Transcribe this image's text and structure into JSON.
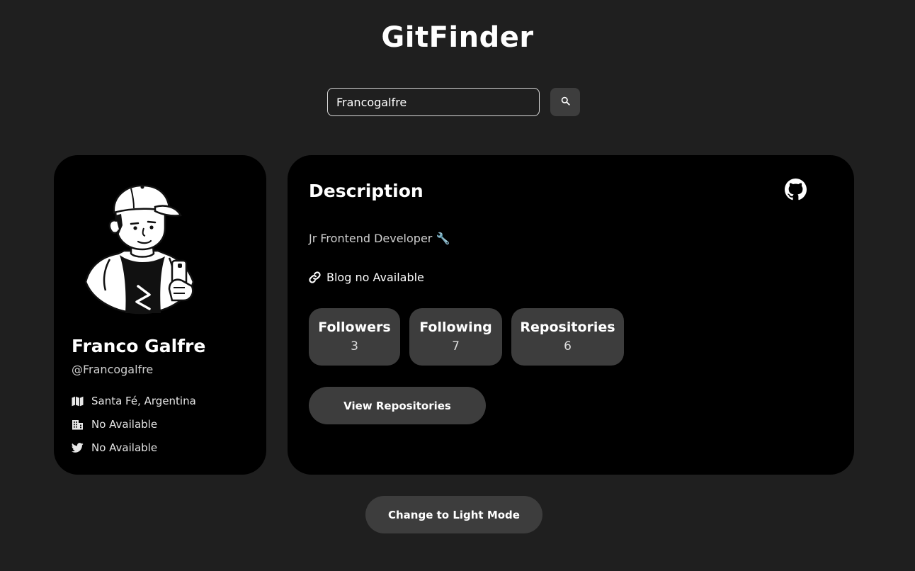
{
  "app": {
    "title": "GitFinder"
  },
  "search": {
    "value": "Francogalfre",
    "placeholder": "",
    "button_icon": "search-icon"
  },
  "profile": {
    "name": "Franco Galfre",
    "handle": "@Francogalfre",
    "location": "Santa Fé, Argentina",
    "company": "No Available",
    "twitter": "No Available",
    "icons": {
      "location": "map-icon",
      "company": "building-icon",
      "twitter": "twitter-icon"
    }
  },
  "details": {
    "title": "Description",
    "bio": "Jr Frontend Developer 🔧",
    "blog": "Blog no Available",
    "stats": [
      {
        "label": "Followers",
        "value": "3"
      },
      {
        "label": "Following",
        "value": "7"
      },
      {
        "label": "Repositories",
        "value": "6"
      }
    ],
    "view_repos_label": "View Repositories",
    "github_icon": "github-icon"
  },
  "theme_toggle": {
    "label": "Change to Light Mode"
  },
  "colors": {
    "page_background": "#1f1f1f",
    "card_background": "#000000",
    "button_background": "#3d3d3d",
    "text_primary": "#ffffff",
    "text_secondary": "#cfcfcf"
  }
}
